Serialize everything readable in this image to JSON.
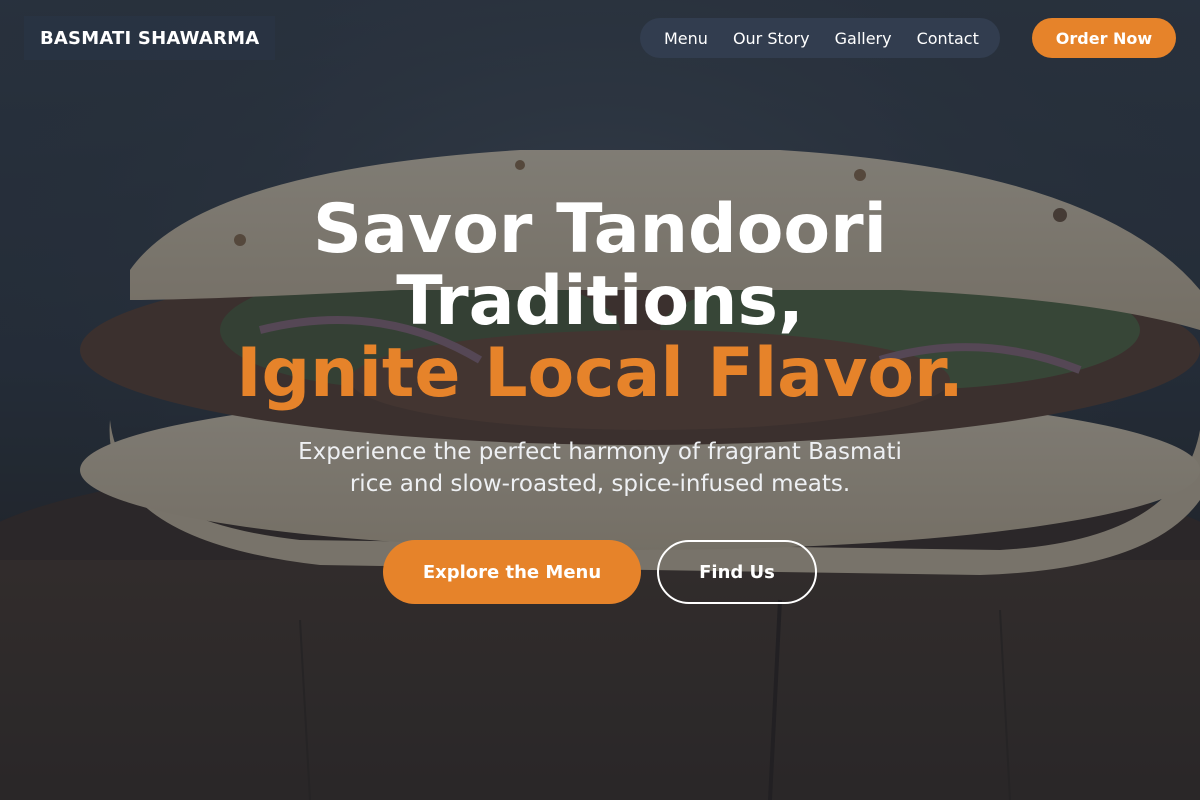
{
  "brand": {
    "name": "BASMATI SHAWARMA"
  },
  "nav": {
    "items": [
      {
        "label": "Menu"
      },
      {
        "label": "Our Story"
      },
      {
        "label": "Gallery"
      },
      {
        "label": "Contact"
      }
    ],
    "order_label": "Order Now"
  },
  "hero": {
    "title_line1": "Savor Tandoori",
    "title_line2": "Traditions,",
    "title_accent": "Ignite Local Flavor.",
    "subtitle": "Experience the perfect harmony of fragrant Basmati rice and slow-roasted, spice-infused meats.",
    "primary_cta": "Explore the Menu",
    "secondary_cta": "Find Us"
  },
  "colors": {
    "accent": "#e6832a",
    "text": "#ffffff",
    "nav_background": "#344052"
  }
}
